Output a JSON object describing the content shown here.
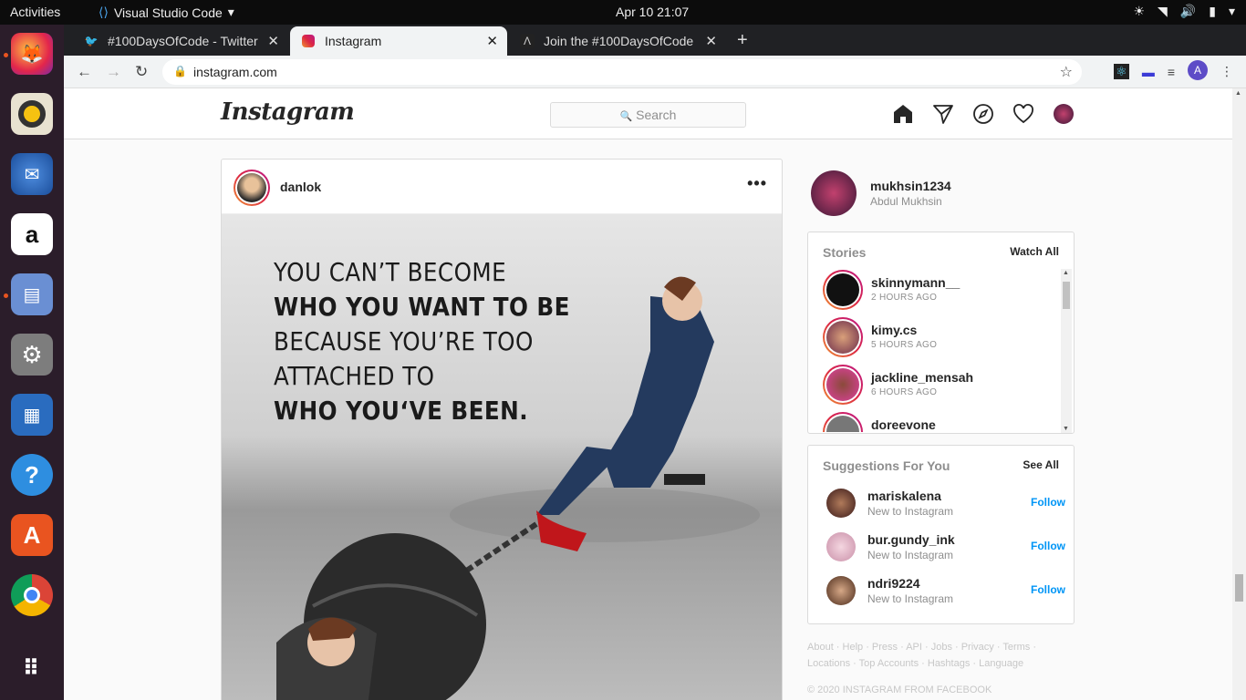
{
  "system": {
    "activities": "Activities",
    "app_name": "Visual Studio Code",
    "clock": "Apr 10  21:07"
  },
  "browser": {
    "tabs": [
      {
        "title": "#100DaysOfCode - Twitter",
        "icon": "twitter-icon"
      },
      {
        "title": "Instagram",
        "icon": "instagram-icon"
      },
      {
        "title": "Join the #100DaysOfCode",
        "icon": "a-icon"
      }
    ],
    "url": "instagram.com",
    "profile_initial": "A"
  },
  "instagram": {
    "logo": "Instagram",
    "search_placeholder": "Search",
    "post": {
      "username": "danlok",
      "more": "•••",
      "quote_lines": [
        "YOU CAN’T BECOME",
        "WHO YOU WANT TO BE",
        "BECAUSE YOU’RE TOO",
        "ATTACHED TO",
        "WHO YOU‘VE BEEN."
      ]
    },
    "me": {
      "username": "mukhsin1234",
      "name": "Abdul Mukhsin"
    },
    "stories": {
      "title": "Stories",
      "action": "Watch All",
      "items": [
        {
          "username": "skinnymann__",
          "time": "2 HOURS AGO"
        },
        {
          "username": "kimy.cs",
          "time": "5 HOURS AGO"
        },
        {
          "username": "jackline_mensah",
          "time": "6 HOURS AGO"
        },
        {
          "username": "doreevone",
          "time": ""
        }
      ]
    },
    "suggestions": {
      "title": "Suggestions For You",
      "action": "See All",
      "items": [
        {
          "username": "mariskalena",
          "sub": "New to Instagram",
          "action": "Follow"
        },
        {
          "username": "bur.gundy_ink",
          "sub": "New to Instagram",
          "action": "Follow"
        },
        {
          "username": "ndri9224",
          "sub": "New to Instagram",
          "action": "Follow"
        }
      ]
    },
    "footer": {
      "line1": "About · Help · Press · API · Jobs · Privacy · Terms ·",
      "line2": "Locations · Top Accounts · Hashtags · Language",
      "copyright": "© 2020 INSTAGRAM FROM FACEBOOK"
    }
  }
}
